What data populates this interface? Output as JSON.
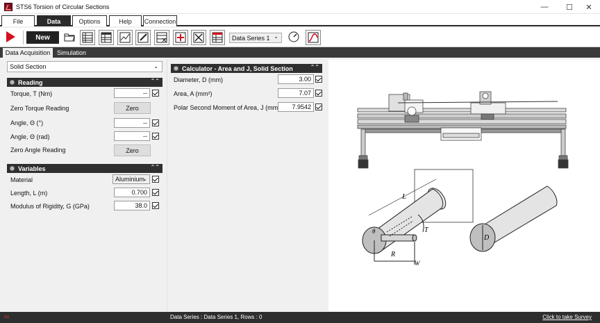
{
  "window": {
    "title": "STS6 Torsion of Circular Sections"
  },
  "menu": {
    "tabs": [
      {
        "label": "File"
      },
      {
        "label": "Data"
      },
      {
        "label": "Options"
      },
      {
        "label": "Help"
      },
      {
        "label": "Connection"
      }
    ]
  },
  "toolbar": {
    "new_label": "New",
    "series_select": "Data Series 1"
  },
  "subtabs": [
    {
      "label": "Data Acquisition"
    },
    {
      "label": "Simulation"
    }
  ],
  "left": {
    "section_select": "Solid Section",
    "reading": {
      "title": "Reading",
      "torque_label": "Torque, T (Nm)",
      "torque_value": "--",
      "zero_torque_label": "Zero Torque Reading",
      "zero_torque_btn": "Zero",
      "angle_deg_label": "Angle, Θ (°)",
      "angle_deg_value": "--",
      "angle_rad_label": "Angle, Θ (rad)",
      "angle_rad_value": "--",
      "zero_angle_label": "Zero Angle Reading",
      "zero_angle_btn": "Zero"
    },
    "variables": {
      "title": "Variables",
      "material_label": "Material",
      "material_value": "Aluminium",
      "length_label": "Length, L (m)",
      "length_value": "0.700",
      "rigidity_label": "Modulus of Rigidity, G (GPa)",
      "rigidity_value": "38.0"
    }
  },
  "calculator": {
    "title": "Calculator - Area and J, Solid Section",
    "diameter_label": "Diameter, D (mm)",
    "diameter_value": "3.00",
    "area_label": "Area, A (mm²)",
    "area_value": "7.07",
    "polar_label": "Polar Second Moment of Area, J (mm⁴)",
    "polar_value": "7.9542"
  },
  "diagram": {
    "labels": {
      "L": "L",
      "T": "T",
      "theta": "θ",
      "R": "R",
      "W": "W",
      "D": "D"
    }
  },
  "status": {
    "text": "Data Series : Data Series 1,  Rows : 0",
    "survey_link": "Click to take Survey"
  },
  "colors": {
    "dark": "#2f2f2f",
    "accent_red": "#d40f1f",
    "window_bg": "#f0f0f0"
  }
}
